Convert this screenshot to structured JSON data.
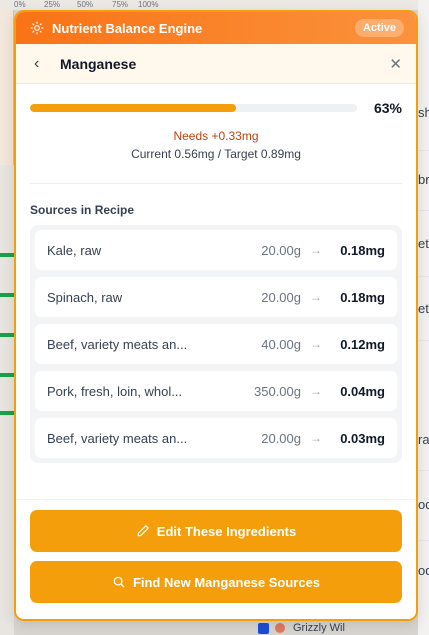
{
  "background": {
    "axis_ticks": [
      "0%",
      "25%",
      "50%",
      "75%",
      "100%"
    ],
    "right_fragments": [
      "sh",
      "br",
      "et",
      "et",
      "ra",
      "od",
      "od"
    ],
    "bottom_item": "Grizzly Wil"
  },
  "engine": {
    "title": "Nutrient Balance Engine",
    "status": "Active"
  },
  "nutrient": {
    "name": "Manganese",
    "progress_percent": 63,
    "progress_label": "63%",
    "needs": "Needs +0.33mg",
    "current_target": "Current 0.56mg / Target 0.89mg"
  },
  "sources": {
    "title": "Sources in Recipe",
    "items": [
      {
        "name": "Kale, raw",
        "quantity": "20.00g",
        "amount": "0.18mg"
      },
      {
        "name": "Spinach, raw",
        "quantity": "20.00g",
        "amount": "0.18mg"
      },
      {
        "name": "Beef, variety meats an...",
        "quantity": "40.00g",
        "amount": "0.12mg"
      },
      {
        "name": "Pork, fresh, loin, whol...",
        "quantity": "350.00g",
        "amount": "0.04mg"
      },
      {
        "name": "Beef, variety meats an...",
        "quantity": "20.00g",
        "amount": "0.03mg"
      }
    ]
  },
  "actions": {
    "edit_label": "Edit These Ingredients",
    "find_label": "Find New Manganese Sources"
  },
  "colors": {
    "accent": "#f59e0b",
    "header": "#f97316",
    "needs_text": "#c2410c"
  }
}
